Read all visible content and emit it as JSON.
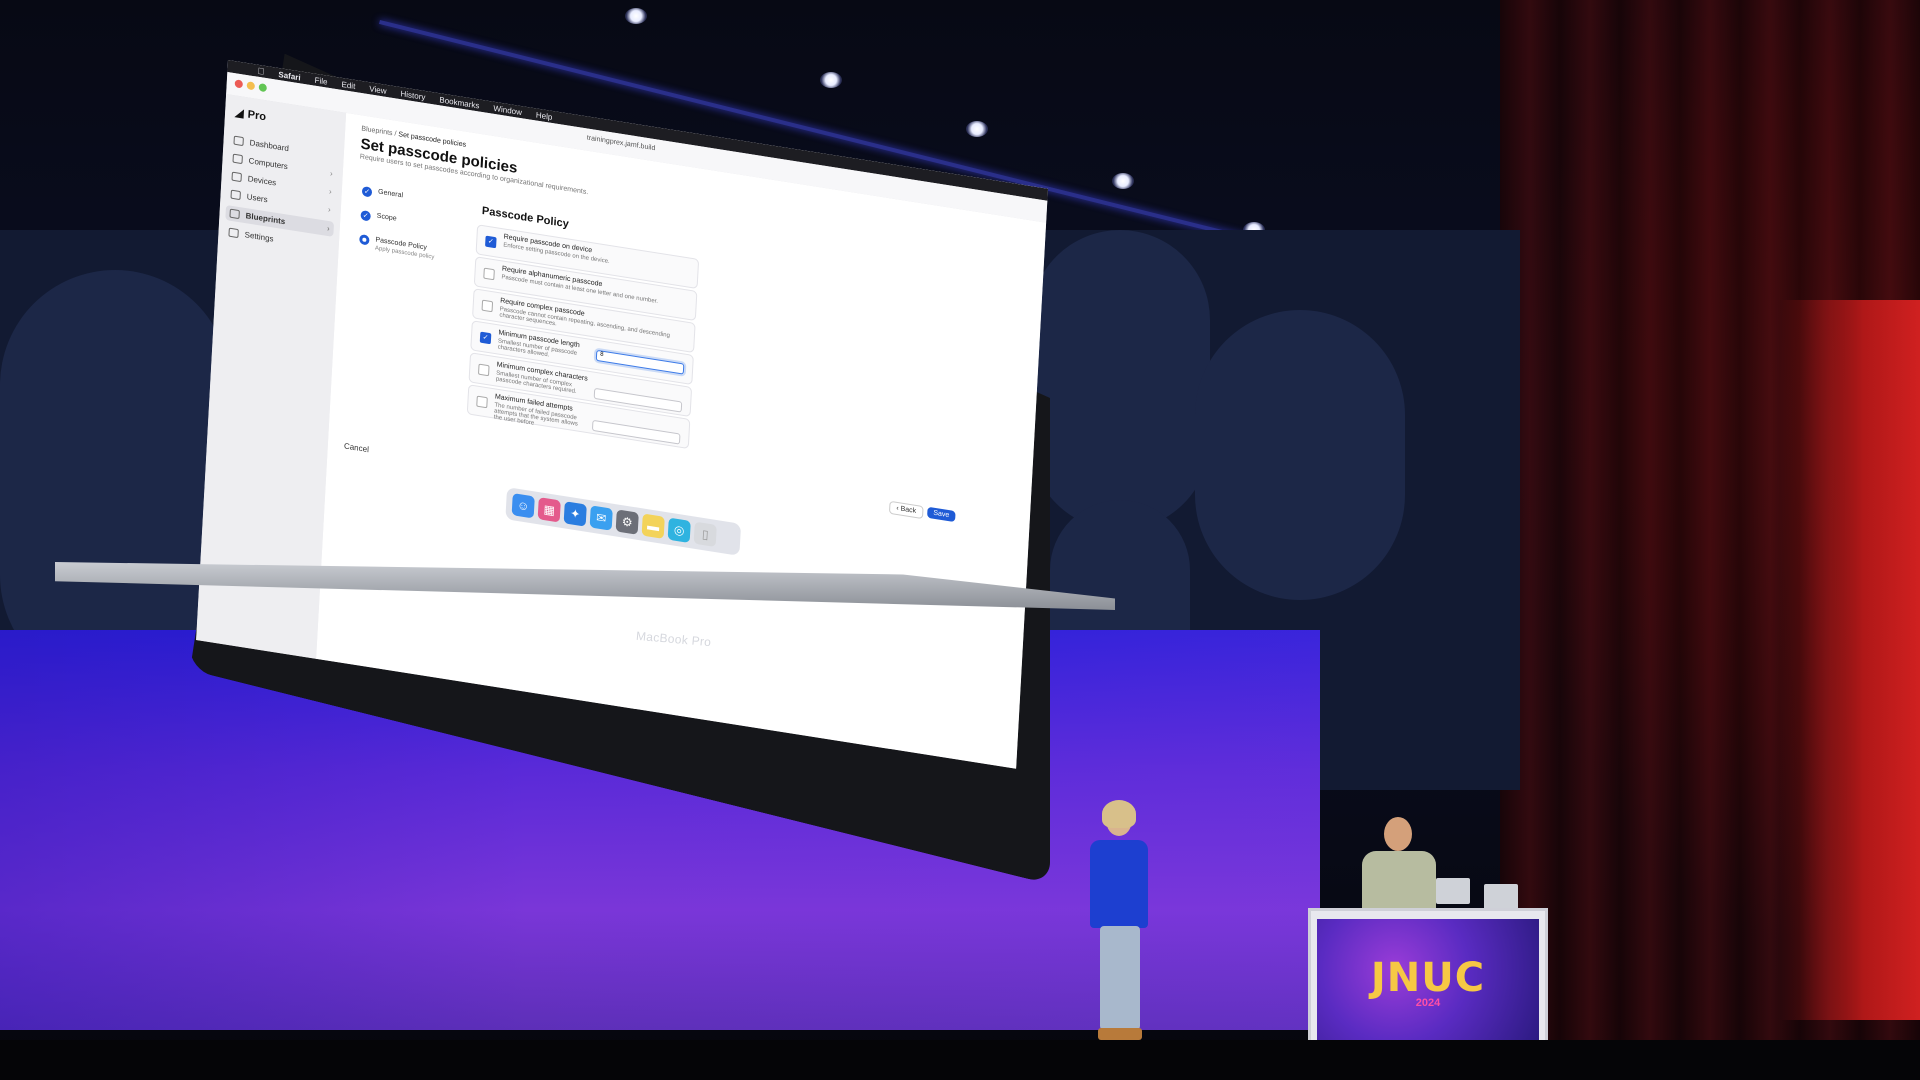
{
  "laptop": {
    "label": "MacBook Pro",
    "menubar": {
      "app": "Safari",
      "items": [
        "File",
        "Edit",
        "View",
        "History",
        "Bookmarks",
        "Window",
        "Help"
      ]
    },
    "browser": {
      "url": "trainingprex.jamf.build"
    },
    "app": {
      "brand": "Pro",
      "sidebar": [
        "Dashboard",
        "Computers",
        "Devices",
        "Users",
        "Blueprints",
        "Settings"
      ],
      "active_sidebar": "Blueprints",
      "breadcrumb_parent": "Blueprints",
      "breadcrumb_current": "Set passcode policies",
      "title": "Set passcode policies",
      "subtitle": "Require users to set passcodes according to organizational requirements.",
      "steps": [
        {
          "label": "General",
          "desc": ""
        },
        {
          "label": "Scope",
          "desc": ""
        },
        {
          "label": "Passcode Policy",
          "desc": "Apply passcode policy"
        }
      ],
      "section_title": "Passcode Policy",
      "options": [
        {
          "title": "Require passcode on device",
          "desc": "Enforce setting passcode on the device.",
          "checked": true
        },
        {
          "title": "Require alphanumeric passcode",
          "desc": "Passcode must contain at least one letter and one number.",
          "checked": false
        },
        {
          "title": "Require complex passcode",
          "desc": "Passcode cannot contain repeating, ascending, and descending character sequences.",
          "checked": false
        },
        {
          "title": "Minimum passcode length",
          "desc": "Smallest number of passcode characters allowed.",
          "checked": true,
          "value": "8"
        },
        {
          "title": "Minimum complex characters",
          "desc": "Smallest number of complex passcode characters required.",
          "checked": false
        },
        {
          "title": "Maximum failed attempts",
          "desc": "The number of failed passcode attempts that the system allows the user before",
          "checked": false
        }
      ],
      "cancel_label": "Cancel",
      "back_label": "Back",
      "save_label": "Save"
    }
  },
  "podium": {
    "logo": "JNUC",
    "year": "2024"
  }
}
